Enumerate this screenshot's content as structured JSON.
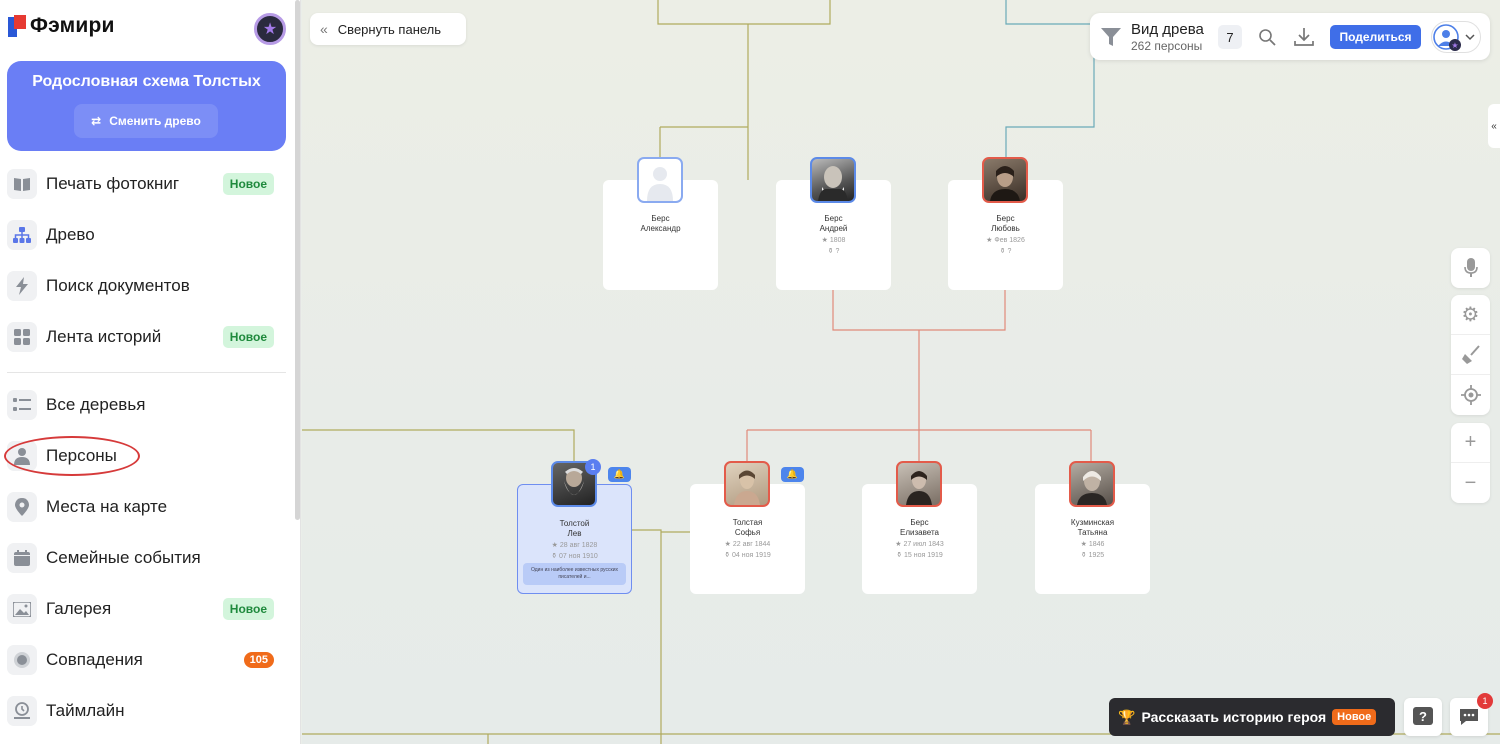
{
  "brand": {
    "name": "Фэмири"
  },
  "tree_card": {
    "title": "Родословная схема Толстых",
    "switch_label": "Сменить древо"
  },
  "nav": {
    "photobook": {
      "label": "Печать фотокниг",
      "badge": "Новое"
    },
    "tree": {
      "label": "Древо"
    },
    "docs": {
      "label": "Поиск документов"
    },
    "stories": {
      "label": "Лента историй",
      "badge": "Новое"
    },
    "all_trees": {
      "label": "Все деревья"
    },
    "persons": {
      "label": "Персоны"
    },
    "map": {
      "label": "Места на карте"
    },
    "events": {
      "label": "Семейные события"
    },
    "gallery": {
      "label": "Галерея",
      "badge": "Новое"
    },
    "matches": {
      "label": "Совпадения",
      "badge": "105"
    },
    "timeline": {
      "label": "Таймлайн"
    }
  },
  "collapse": {
    "label": "Свернуть панель"
  },
  "view": {
    "title": "Вид древа",
    "subtitle": "262 персоны",
    "count": "7",
    "share_label": "Поделиться"
  },
  "persons": {
    "alexander": {
      "line1": "Берс",
      "line2": "Александр"
    },
    "andrey": {
      "line1": "Берс",
      "line2": "Андрей",
      "birth": "1808",
      "death": "?"
    },
    "lyubov": {
      "line1": "Берс",
      "line2": "Любовь",
      "birth": "Фев 1826",
      "death": "?"
    },
    "lev": {
      "line1": "Толстой",
      "line2": "Лев",
      "birth": "28 авг 1828",
      "death": "07 ноя 1910",
      "note": "Один из наиболее известных русских писателей и...",
      "badge": "1"
    },
    "sofia": {
      "line1": "Толстая",
      "line2": "Софья",
      "birth": "22 авг 1844",
      "death": "04 ноя 1919"
    },
    "elizaveta": {
      "line1": "Берс",
      "line2": "Елизавета",
      "birth": "27 июл 1843",
      "death": "15 ноя 1919"
    },
    "tatyana": {
      "line1": "Кузминская",
      "line2": "Татьяна",
      "birth": "1846",
      "death": "1925"
    }
  },
  "bottom": {
    "story_label": "Рассказать историю героя",
    "story_badge": "Новое",
    "chat_badge": "1"
  },
  "colors": {
    "accent": "#6a7ef5",
    "share": "#3f6ee8",
    "male": "#5c8ae8",
    "female": "#e35b4a",
    "line_olive": "#b0ab5e",
    "line_teal": "#6aaab8",
    "line_red": "#e08a7a"
  }
}
